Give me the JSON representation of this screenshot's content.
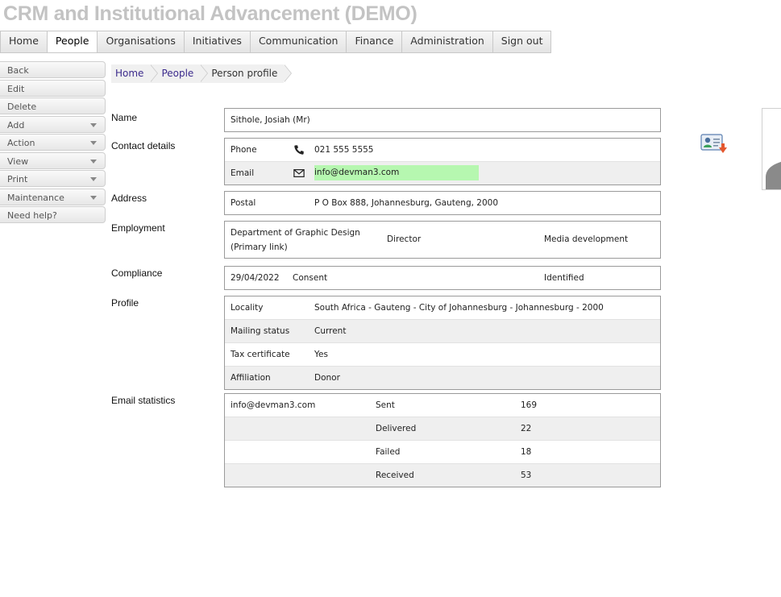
{
  "app": {
    "title": "CRM and Institutional Advancement (DEMO)"
  },
  "topnav": [
    {
      "label": "Home"
    },
    {
      "label": "People"
    },
    {
      "label": "Organisations"
    },
    {
      "label": "Initiatives"
    },
    {
      "label": "Communication"
    },
    {
      "label": "Finance"
    },
    {
      "label": "Administration"
    },
    {
      "label": "Sign out"
    }
  ],
  "topnav_active": "People",
  "sidemenu": [
    {
      "label": "Back"
    },
    {
      "label": "Edit"
    },
    {
      "label": "Delete"
    },
    {
      "label": "Add"
    },
    {
      "label": "Action"
    },
    {
      "label": "View"
    },
    {
      "label": "Print"
    },
    {
      "label": "Maintenance"
    },
    {
      "label": "Need help?"
    }
  ],
  "breadcrumb": [
    {
      "label": "Home"
    },
    {
      "label": "People"
    },
    {
      "label": "Person profile"
    }
  ],
  "profile": {
    "name_label": "Name",
    "name_value": "Sithole, Josiah (Mr)",
    "contact_label": "Contact details",
    "phone_label": "Phone",
    "phone_value": "021 555 5555",
    "email_label": "Email",
    "email_value": "info@devman3.com",
    "address_label": "Address",
    "postal_label": "Postal",
    "postal_value": "P O Box 888, Johannesburg, Gauteng, 2000",
    "employment_label": "Employment",
    "employment_org": "Department of Graphic Design",
    "employment_link": "(Primary link)",
    "employment_title": "Director",
    "employment_area": "Media development",
    "compliance_label": "Compliance",
    "compliance_date": "29/04/2022",
    "compliance_type": "Consent",
    "compliance_status": "Identified",
    "profile_label": "Profile",
    "locality_label": "Locality",
    "locality_value": "South Africa - Gauteng - City of Johannesburg - Johannesburg - 2000",
    "mailing_label": "Mailing status",
    "mailing_value": "Current",
    "tax_label": "Tax certificate",
    "tax_value": "Yes",
    "affiliation_label": "Affiliation",
    "affiliation_value": "Donor",
    "emailstats_label": "Email statistics",
    "emailstats_address": "info@devman3.com",
    "stats": [
      {
        "label": "Sent",
        "value": "169"
      },
      {
        "label": "Delivered",
        "value": "22"
      },
      {
        "label": "Failed",
        "value": "18"
      },
      {
        "label": "Received",
        "value": "53"
      }
    ]
  },
  "icons": {
    "phone": "phone-icon",
    "email": "envelope-icon",
    "vcard": "vcard-download-icon"
  },
  "colors": {
    "title": "#c3c3c3",
    "email_highlight": "#b6f7b0",
    "link": "#3b2a8c"
  }
}
